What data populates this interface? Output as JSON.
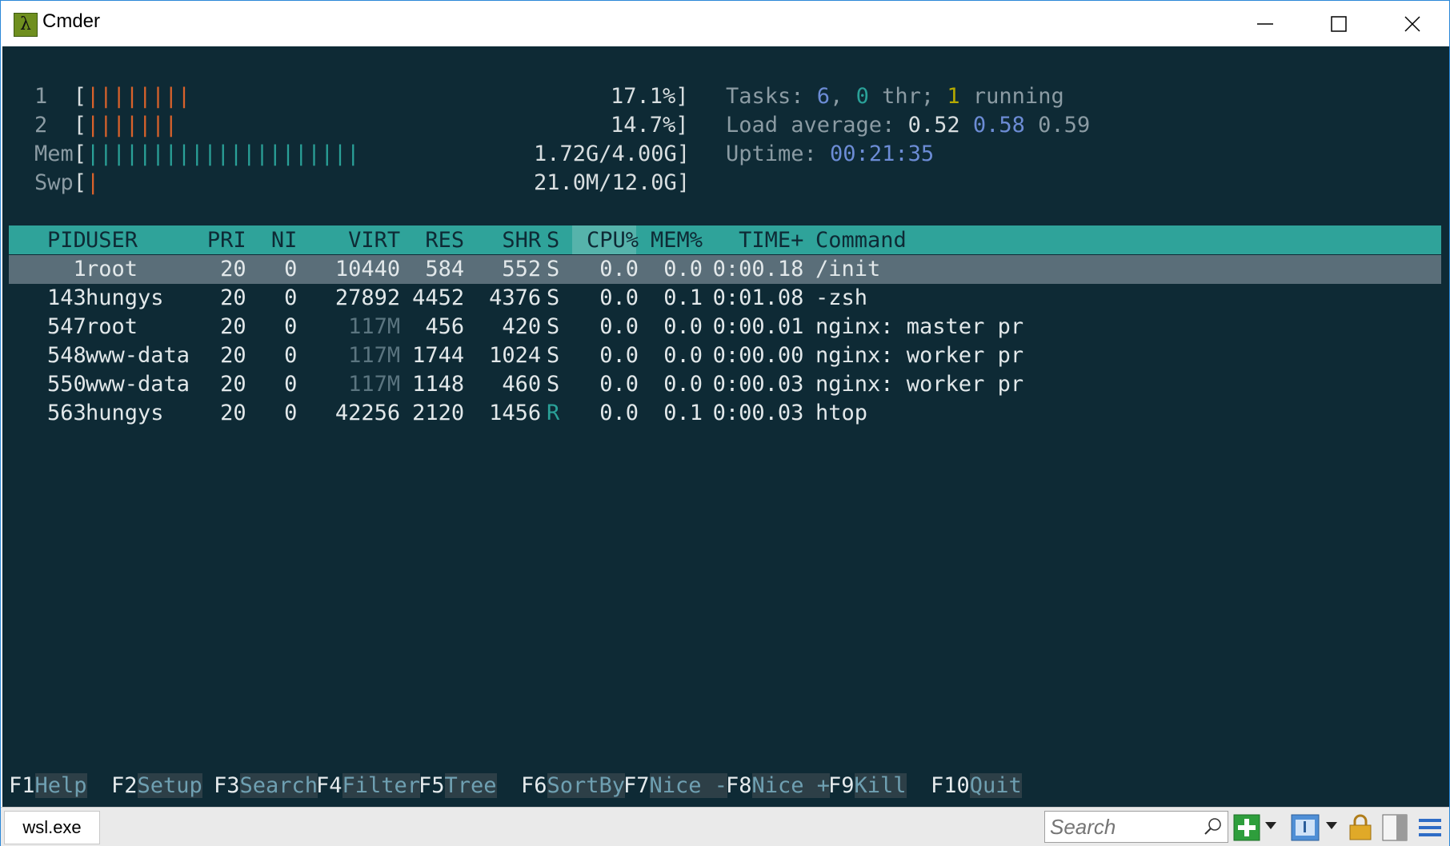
{
  "window": {
    "title": "Cmder",
    "app_icon_glyph": "λ"
  },
  "meters": {
    "cpu1": {
      "label": "1",
      "bars": "||||||||",
      "value": "17.1%"
    },
    "cpu2": {
      "label": "2",
      "bars": "|||||||",
      "value": "14.7%"
    },
    "mem": {
      "label": "Mem",
      "bars": "|||||||||||||||||||||",
      "value": "1.72G/4.00G"
    },
    "swp": {
      "label": "Swp",
      "bars": "|",
      "value": "21.0M/12.0G"
    }
  },
  "summary": {
    "tasks_label": "Tasks: ",
    "tasks": "6",
    "thr": "0",
    "thr_label": " thr; ",
    "running": "1",
    "running_label": " running",
    "load_label": "Load average: ",
    "load1": "0.52",
    "load5": "0.58",
    "load15": "0.59",
    "uptime_label": "Uptime: ",
    "uptime": "00:21:35"
  },
  "table": {
    "headers": [
      "PID",
      "USER",
      "PRI",
      "NI",
      "VIRT",
      "RES",
      "SHR",
      "S",
      "CPU%",
      "MEM%",
      "TIME+",
      "Command"
    ],
    "rows": [
      {
        "pid": "1",
        "user": "root",
        "pri": "20",
        "ni": "0",
        "virt": "10440",
        "res": "584",
        "shr": "552",
        "s": "S",
        "cpu": "0.0",
        "mem": "0.0",
        "time": "0:00.18",
        "cmd": "/init"
      },
      {
        "pid": "143",
        "user": "hungys",
        "pri": "20",
        "ni": "0",
        "virt": "27892",
        "res": "4452",
        "shr": "4376",
        "s": "S",
        "cpu": "0.0",
        "mem": "0.1",
        "time": "0:01.08",
        "cmd": "-zsh"
      },
      {
        "pid": "547",
        "user": "root",
        "pri": "20",
        "ni": "0",
        "virt": "117M",
        "res": "456",
        "shr": "420",
        "s": "S",
        "cpu": "0.0",
        "mem": "0.0",
        "time": "0:00.01",
        "cmd": "nginx: master pr"
      },
      {
        "pid": "548",
        "user": "www-data",
        "pri": "20",
        "ni": "0",
        "virt": "117M",
        "res": "1744",
        "shr": "1024",
        "s": "S",
        "cpu": "0.0",
        "mem": "0.0",
        "time": "0:00.00",
        "cmd": "nginx: worker pr"
      },
      {
        "pid": "550",
        "user": "www-data",
        "pri": "20",
        "ni": "0",
        "virt": "117M",
        "res": "1148",
        "shr": "460",
        "s": "S",
        "cpu": "0.0",
        "mem": "0.0",
        "time": "0:00.03",
        "cmd": "nginx: worker pr"
      },
      {
        "pid": "563",
        "user": "hungys",
        "pri": "20",
        "ni": "0",
        "virt": "42256",
        "res": "2120",
        "shr": "1456",
        "s": "R",
        "cpu": "0.0",
        "mem": "0.1",
        "time": "0:00.03",
        "cmd": "htop"
      }
    ]
  },
  "fkeys": [
    {
      "key": "F1",
      "label": "Help  "
    },
    {
      "key": "F2",
      "label": "Setup "
    },
    {
      "key": "F3",
      "label": "Search"
    },
    {
      "key": "F4",
      "label": "Filter"
    },
    {
      "key": "F5",
      "label": "Tree  "
    },
    {
      "key": "F6",
      "label": "SortBy"
    },
    {
      "key": "F7",
      "label": "Nice -"
    },
    {
      "key": "F8",
      "label": "Nice +"
    },
    {
      "key": "F9",
      "label": "Kill  "
    },
    {
      "key": "F10",
      "label": "Quit  "
    }
  ],
  "statusbar": {
    "tab_label": "wsl.exe",
    "search_placeholder": "Search"
  },
  "colors": {
    "terminal_bg": "#0e2a35",
    "header_bg": "#2fa39a",
    "selected_row_bg": "#5a6e79",
    "cpu_bar": "#d9622b",
    "mem_bar": "#2aa198"
  },
  "icons": [
    "minimize-icon",
    "maximize-icon",
    "close-icon",
    "search-icon",
    "new-console-icon",
    "dropdown-icon",
    "tab-icon",
    "lock-icon",
    "split-icon",
    "menu-icon"
  ]
}
